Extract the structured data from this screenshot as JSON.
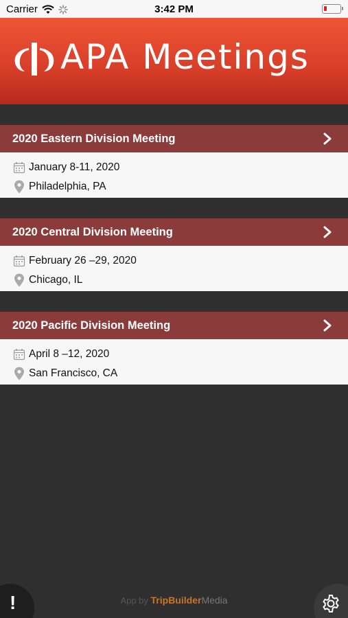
{
  "status": {
    "carrier": "Carrier",
    "time": "3:42 PM"
  },
  "header": {
    "title": "APA Meetings",
    "brand_color": "#d9402a"
  },
  "meetings": [
    {
      "title": "2020 Eastern Division Meeting",
      "dates": "January 8-11, 2020",
      "location": "Philadelphia, PA"
    },
    {
      "title": "2020 Central Division Meeting",
      "dates": "February 26 –29, 2020",
      "location": "Chicago, IL"
    },
    {
      "title": "2020 Pacific Division Meeting",
      "dates": "April 8 –12, 2020",
      "location": "San Francisco, CA"
    }
  ],
  "footer": {
    "alert_label": "!",
    "brand_prefix": "App by",
    "brand_name_1": "TripBuilder",
    "brand_name_2": "Media"
  },
  "icons": {
    "calendar": "calendar-icon",
    "location": "map-pin-icon",
    "chevron": "chevron-right-icon",
    "settings": "gear-icon"
  }
}
